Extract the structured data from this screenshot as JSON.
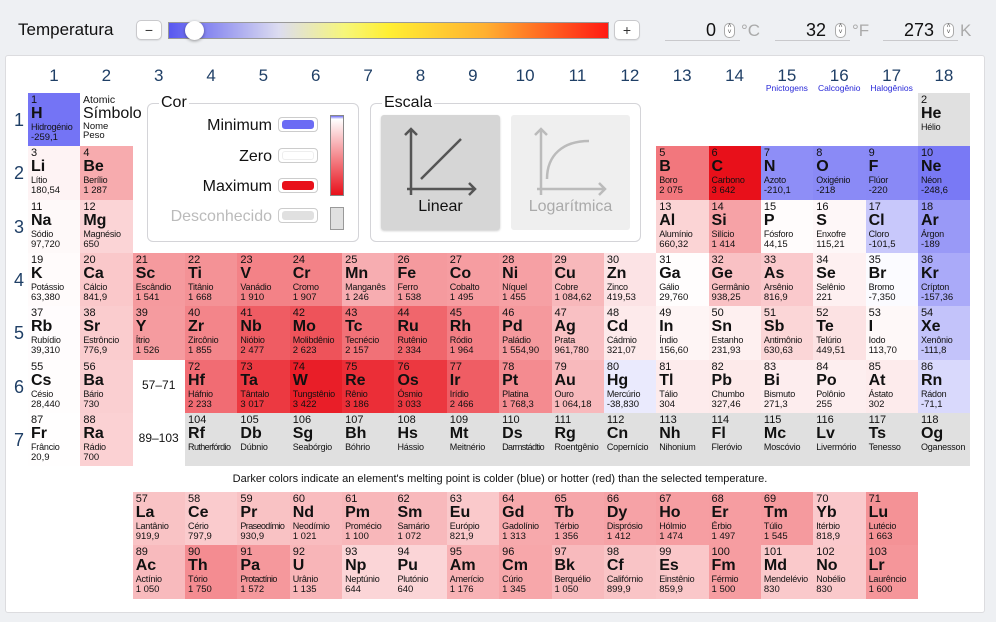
{
  "toolbar": {
    "title": "Temperatura",
    "minus_label": "−",
    "plus_label": "+",
    "slider_position_percent": 6,
    "celsius": "0",
    "celsius_unit": "°C",
    "fahrenheit": "32",
    "fahrenheit_unit": "°F",
    "kelvin": "273",
    "kelvin_unit": "K"
  },
  "groups": [
    "1",
    "2",
    "3",
    "4",
    "5",
    "6",
    "7",
    "8",
    "9",
    "10",
    "11",
    "12",
    "13",
    "14",
    "15",
    "16",
    "17",
    "18"
  ],
  "group_names": {
    "15": "Pnictogens",
    "16": "Calcogênio",
    "17": "Halogênios"
  },
  "periods": [
    "1",
    "2",
    "3",
    "4",
    "5",
    "6",
    "7"
  ],
  "series_periods": [
    "6",
    "7"
  ],
  "placeholders": {
    "lanthanides": "57–71",
    "actinides": "89–103"
  },
  "key": {
    "number": "Atomic",
    "symbol": "Símbolo",
    "name": "Nome",
    "weight": "Peso"
  },
  "color_box": {
    "title": "Cor",
    "minimum": "Minimum",
    "zero": "Zero",
    "maximum": "Maximum",
    "unknown": "Desconhecido",
    "min_color": "#6c6cf4",
    "zero_color": "#ffffff",
    "max_color": "#e8101a",
    "unknown_color": "#e0e0e0"
  },
  "scale_box": {
    "title": "Escala",
    "linear": "Linear",
    "log": "Logarítmica",
    "selected": "Linear"
  },
  "note": "Darker colors indicate an element's melting point is colder (blue) or hotter (red) than the selected temperature.",
  "elements": [
    [
      1,
      "H",
      "Hidrogénio",
      "-259,1"
    ],
    [
      2,
      "He",
      "Hélio",
      ""
    ],
    [
      3,
      "Li",
      "Lítio",
      "180,54"
    ],
    [
      4,
      "Be",
      "Berílio",
      "1 287"
    ],
    [
      5,
      "B",
      "Boro",
      "2 075"
    ],
    [
      6,
      "C",
      "Carbono",
      "3 642"
    ],
    [
      7,
      "N",
      "Azoto",
      "-210,1"
    ],
    [
      8,
      "O",
      "Oxigénio",
      "-218"
    ],
    [
      9,
      "F",
      "Flúor",
      "-220"
    ],
    [
      10,
      "Ne",
      "Néon",
      "-248,6"
    ],
    [
      11,
      "Na",
      "Sódio",
      "97,720"
    ],
    [
      12,
      "Mg",
      "Magnésio",
      "650"
    ],
    [
      13,
      "Al",
      "Alumínio",
      "660,32"
    ],
    [
      14,
      "Si",
      "Silício",
      "1 414"
    ],
    [
      15,
      "P",
      "Fósforo",
      "44,15"
    ],
    [
      16,
      "S",
      "Enxofre",
      "115,21"
    ],
    [
      17,
      "Cl",
      "Cloro",
      "-101,5"
    ],
    [
      18,
      "Ar",
      "Árgon",
      "-189"
    ],
    [
      19,
      "K",
      "Potássio",
      "63,380"
    ],
    [
      20,
      "Ca",
      "Cálcio",
      "841,9"
    ],
    [
      21,
      "Sc",
      "Escândio",
      "1 541"
    ],
    [
      22,
      "Ti",
      "Titânio",
      "1 668"
    ],
    [
      23,
      "V",
      "Vanádio",
      "1 910"
    ],
    [
      24,
      "Cr",
      "Cromo",
      "1 907"
    ],
    [
      25,
      "Mn",
      "Manganês",
      "1 246"
    ],
    [
      26,
      "Fe",
      "Ferro",
      "1 538"
    ],
    [
      27,
      "Co",
      "Cobalto",
      "1 495"
    ],
    [
      28,
      "Ni",
      "Níquel",
      "1 455"
    ],
    [
      29,
      "Cu",
      "Cobre",
      "1 084,62"
    ],
    [
      30,
      "Zn",
      "Zinco",
      "419,53"
    ],
    [
      31,
      "Ga",
      "Gálio",
      "29,760"
    ],
    [
      32,
      "Ge",
      "Germânio",
      "938,25"
    ],
    [
      33,
      "As",
      "Arsênio",
      "816,9"
    ],
    [
      34,
      "Se",
      "Selênio",
      "221"
    ],
    [
      35,
      "Br",
      "Bromo",
      "-7,350"
    ],
    [
      36,
      "Kr",
      "Crípton",
      "-157,36"
    ],
    [
      37,
      "Rb",
      "Rubídio",
      "39,310"
    ],
    [
      38,
      "Sr",
      "Estrôncio",
      "776,9"
    ],
    [
      39,
      "Y",
      "Ítrio",
      "1 526"
    ],
    [
      40,
      "Zr",
      "Zircônio",
      "1 855"
    ],
    [
      41,
      "Nb",
      "Nióbio",
      "2 477"
    ],
    [
      42,
      "Mo",
      "Molibdênio",
      "2 623"
    ],
    [
      43,
      "Tc",
      "Tecnécio",
      "2 157"
    ],
    [
      44,
      "Ru",
      "Rutênio",
      "2 334"
    ],
    [
      45,
      "Rh",
      "Ródio",
      "1 964"
    ],
    [
      46,
      "Pd",
      "Paládio",
      "1 554,90"
    ],
    [
      47,
      "Ag",
      "Prata",
      "961,780"
    ],
    [
      48,
      "Cd",
      "Cádmio",
      "321,07"
    ],
    [
      49,
      "In",
      "Índio",
      "156,60"
    ],
    [
      50,
      "Sn",
      "Estanho",
      "231,93"
    ],
    [
      51,
      "Sb",
      "Antimônio",
      "630,63"
    ],
    [
      52,
      "Te",
      "Telúrio",
      "449,51"
    ],
    [
      53,
      "I",
      "Iodo",
      "113,70"
    ],
    [
      54,
      "Xe",
      "Xenônio",
      "-111,8"
    ],
    [
      55,
      "Cs",
      "Césio",
      "28,440"
    ],
    [
      56,
      "Ba",
      "Bário",
      "730"
    ],
    [
      57,
      "La",
      "Lantânio",
      "919,9"
    ],
    [
      58,
      "Ce",
      "Cério",
      "797,9"
    ],
    [
      59,
      "Pr",
      "Praseodímio",
      "930,9"
    ],
    [
      60,
      "Nd",
      "Neodímio",
      "1 021"
    ],
    [
      61,
      "Pm",
      "Promécio",
      "1 100"
    ],
    [
      62,
      "Sm",
      "Samário",
      "1 072"
    ],
    [
      63,
      "Eu",
      "Európio",
      "821,9"
    ],
    [
      64,
      "Gd",
      "Gadolínio",
      "1 313"
    ],
    [
      65,
      "Tb",
      "Térbio",
      "1 356"
    ],
    [
      66,
      "Dy",
      "Disprósio",
      "1 412"
    ],
    [
      67,
      "Ho",
      "Hólmio",
      "1 474"
    ],
    [
      68,
      "Er",
      "Érbio",
      "1 497"
    ],
    [
      69,
      "Tm",
      "Túlio",
      "1 545"
    ],
    [
      70,
      "Yb",
      "Itérbio",
      "818,9"
    ],
    [
      71,
      "Lu",
      "Lutécio",
      "1 663"
    ],
    [
      72,
      "Hf",
      "Háfnio",
      "2 233"
    ],
    [
      73,
      "Ta",
      "Tântalo",
      "3 017"
    ],
    [
      74,
      "W",
      "Tungstênio",
      "3 422"
    ],
    [
      75,
      "Re",
      "Rênio",
      "3 186"
    ],
    [
      76,
      "Os",
      "Ósmio",
      "3 033"
    ],
    [
      77,
      "Ir",
      "Irídio",
      "2 466"
    ],
    [
      78,
      "Pt",
      "Platina",
      "1 768,3"
    ],
    [
      79,
      "Au",
      "Ouro",
      "1 064,18"
    ],
    [
      80,
      "Hg",
      "Mercúrio",
      "-38,830"
    ],
    [
      81,
      "Tl",
      "Tálio",
      "304"
    ],
    [
      82,
      "Pb",
      "Chumbo",
      "327,46"
    ],
    [
      83,
      "Bi",
      "Bismuto",
      "271,3"
    ],
    [
      84,
      "Po",
      "Polônio",
      "255"
    ],
    [
      85,
      "At",
      "Ástato",
      "302"
    ],
    [
      86,
      "Rn",
      "Rádon",
      "-71,1"
    ],
    [
      87,
      "Fr",
      "Frâncio",
      "20,9"
    ],
    [
      88,
      "Ra",
      "Rádio",
      "700"
    ],
    [
      89,
      "Ac",
      "Actínio",
      "1 050"
    ],
    [
      90,
      "Th",
      "Tório",
      "1 750"
    ],
    [
      91,
      "Pa",
      "Protactínio",
      "1 572"
    ],
    [
      92,
      "U",
      "Urânio",
      "1 135"
    ],
    [
      93,
      "Np",
      "Neptúnio",
      "644"
    ],
    [
      94,
      "Pu",
      "Plutónio",
      "640"
    ],
    [
      95,
      "Am",
      "Amerício",
      "1 176"
    ],
    [
      96,
      "Cm",
      "Cúrio",
      "1 345"
    ],
    [
      97,
      "Bk",
      "Berquélio",
      "1 050"
    ],
    [
      98,
      "Cf",
      "Califórnio",
      "899,9"
    ],
    [
      99,
      "Es",
      "Einstênio",
      "859,9"
    ],
    [
      100,
      "Fm",
      "Férmio",
      "1 500"
    ],
    [
      101,
      "Md",
      "Mendelévio",
      "830"
    ],
    [
      102,
      "No",
      "Nobélio",
      "830"
    ],
    [
      103,
      "Lr",
      "Laurêncio",
      "1 600"
    ],
    [
      104,
      "Rf",
      "Rutherfórdio",
      ""
    ],
    [
      105,
      "Db",
      "Dúbnio",
      ""
    ],
    [
      106,
      "Sg",
      "Seabórgio",
      ""
    ],
    [
      107,
      "Bh",
      "Bóhrio",
      ""
    ],
    [
      108,
      "Hs",
      "Hássio",
      ""
    ],
    [
      109,
      "Mt",
      "Meitnério",
      ""
    ],
    [
      110,
      "Ds",
      "Darmstádtio",
      ""
    ],
    [
      111,
      "Rg",
      "Roentgênio",
      ""
    ],
    [
      112,
      "Cn",
      "Copernício",
      ""
    ],
    [
      113,
      "Nh",
      "Nihonium",
      ""
    ],
    [
      114,
      "Fl",
      "Fleróvio",
      ""
    ],
    [
      115,
      "Mc",
      "Moscóvio",
      ""
    ],
    [
      116,
      "Lv",
      "Livermório",
      ""
    ],
    [
      117,
      "Ts",
      "Tenesso",
      ""
    ],
    [
      118,
      "Og",
      "Oganesson",
      ""
    ]
  ]
}
